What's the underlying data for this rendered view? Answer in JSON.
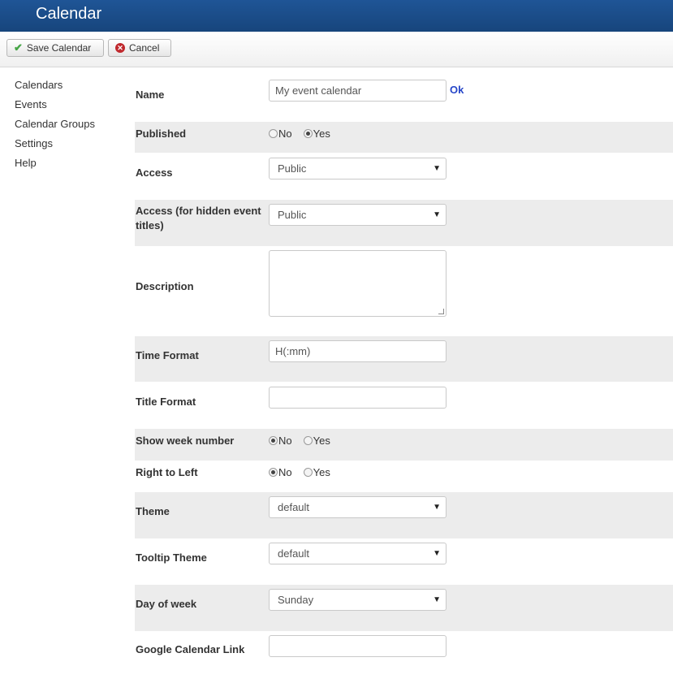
{
  "header": {
    "title": "Calendar"
  },
  "toolbar": {
    "save_label": "Save Calendar",
    "cancel_label": "Cancel"
  },
  "sidebar": {
    "items": [
      {
        "label": "Calendars"
      },
      {
        "label": "Events"
      },
      {
        "label": "Calendar Groups"
      },
      {
        "label": "Settings"
      },
      {
        "label": "Help"
      }
    ]
  },
  "form": {
    "name": {
      "label": "Name",
      "value": "My event calendar",
      "ok": "Ok"
    },
    "published": {
      "label": "Published",
      "options": [
        "No",
        "Yes"
      ],
      "selected": "Yes"
    },
    "access": {
      "label": "Access",
      "value": "Public"
    },
    "access_hidden": {
      "label": "Access (for hidden event titles)",
      "value": "Public"
    },
    "description": {
      "label": "Description",
      "value": ""
    },
    "time_format": {
      "label": "Time Format",
      "value": "H(:mm)"
    },
    "title_format": {
      "label": "Title Format",
      "value": ""
    },
    "show_week_number": {
      "label": "Show week number",
      "options": [
        "No",
        "Yes"
      ],
      "selected": "No"
    },
    "right_to_left": {
      "label": "Right to Left",
      "options": [
        "No",
        "Yes"
      ],
      "selected": "No"
    },
    "theme": {
      "label": "Theme",
      "value": "default"
    },
    "tooltip_theme": {
      "label": "Tooltip Theme",
      "value": "default"
    },
    "day_of_week": {
      "label": "Day of week",
      "value": "Sunday"
    },
    "google_link": {
      "label": "Google Calendar Link",
      "value": ""
    }
  },
  "colors": {
    "header": "#1f5596",
    "row_shade": "#ececec",
    "link": "#2646c8"
  }
}
